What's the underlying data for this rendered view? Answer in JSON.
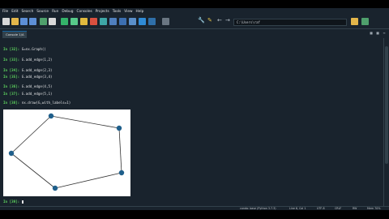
{
  "menu": [
    "File",
    "Edit",
    "Search",
    "Source",
    "Run",
    "Debug",
    "Consoles",
    "Projects",
    "Tools",
    "View",
    "Help"
  ],
  "toolbar": {
    "path": "C:\\Users\\raf"
  },
  "tab": {
    "label": "Console 1/A"
  },
  "console": {
    "lines": [
      {
        "n": "In [32]:",
        "code": "G=nx.Graph()"
      },
      {
        "n": "In [33]:",
        "code": "G.add_edge(1,2)"
      },
      {
        "n": "In [34]:",
        "code": "G.add_edge(2,3)"
      },
      {
        "n": "In [35]:",
        "code": "G.add_edge(3,4)"
      },
      {
        "n": "In [36]:",
        "code": "G.add_edge(4,5)"
      },
      {
        "n": "In [37]:",
        "code": "G.add_edge(5,1)"
      },
      {
        "n": "In [38]:",
        "code": "nx.draw(G,with_labels=1)"
      }
    ],
    "next_prompt": "In [39]:"
  },
  "graph": {
    "edges": [
      [
        1,
        2
      ],
      [
        2,
        3
      ],
      [
        3,
        4
      ],
      [
        4,
        5
      ],
      [
        5,
        1
      ]
    ],
    "node_color": "#1f5f8b",
    "edge_color": "#333333"
  },
  "status": {
    "env": "conda: base (Python 3.7.3)",
    "position": "Line 6, Col 1",
    "encoding": "UTF-8",
    "eol": "CRLF",
    "mode": "RW",
    "memory": "Mem 70%"
  },
  "colors": {
    "background": "#19232d",
    "prompt": "#5fd75f"
  }
}
